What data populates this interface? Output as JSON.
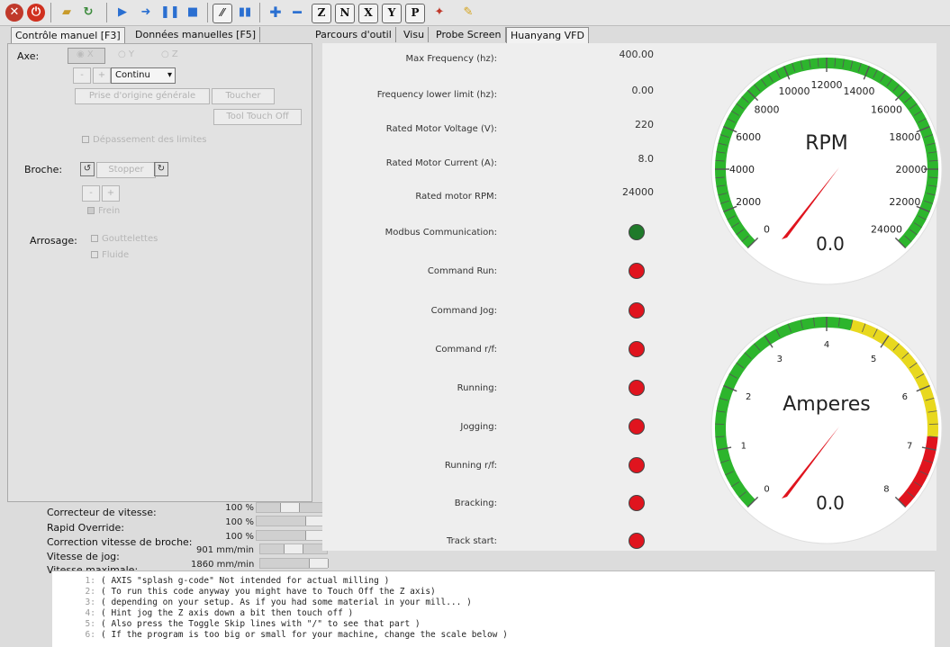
{
  "toolbar": {
    "icons": [
      "stop-icon",
      "estop-icon",
      "open-folder-icon",
      "reload-icon",
      "run-icon",
      "step-icon",
      "pause-icon",
      "stop-program-icon",
      "block-delete-icon",
      "optional-stop-icon",
      "zoom-in-icon",
      "zoom-out-icon",
      "view-z-icon",
      "view-rotated-z-icon",
      "view-x-icon",
      "view-y-icon",
      "view-perspective-icon",
      "rotate-view-icon",
      "clear-plot-icon"
    ],
    "view_z": "Z",
    "view_rz": "N",
    "view_x": "X",
    "view_y": "Y",
    "view_p": "P"
  },
  "tabs_left": [
    "Contrôle manuel [F3]",
    "Données manuelles [F5]"
  ],
  "tabs_right": [
    "Parcours d'outil",
    "Visu",
    "Probe Screen",
    "Huanyang VFD"
  ],
  "manual": {
    "axis_label": "Axe:",
    "axes": [
      "X",
      "Y",
      "Z"
    ],
    "minus": "-",
    "plus": "+",
    "jog_mode": "Continu",
    "home_button": "Prise d'origine générale",
    "touch_button": "Toucher",
    "tool_touch_off": "Tool Touch Off",
    "override_limits": "Dépassement des limites",
    "spindle_label": "Broche:",
    "spindle_stop": "Stopper",
    "brake": "Frein",
    "coolant_label": "Arrosage:",
    "mist": "Gouttelettes",
    "flood": "Fluide"
  },
  "overrides": [
    {
      "label": "Correcteur de vitesse:",
      "value": "100 %"
    },
    {
      "label": "Rapid Override:",
      "value": "100 %"
    },
    {
      "label": "Correction vitesse de broche:",
      "value": "100 %"
    },
    {
      "label": "Vitesse de jog:",
      "value": "901 mm/min"
    },
    {
      "label": "Vitesse maximale:",
      "value": "1860 mm/min"
    }
  ],
  "vfd": {
    "params": [
      {
        "label": "Max Frequency (hz):",
        "value": "400.00"
      },
      {
        "label": "Frequency lower limit (hz):",
        "value": "0.00"
      },
      {
        "label": "Rated Motor Voltage (V):",
        "value": "220"
      },
      {
        "label": "Rated Motor Current (A):",
        "value": "8.0"
      },
      {
        "label": "Rated motor RPM:",
        "value": "24000"
      }
    ],
    "status": [
      {
        "label": "Modbus Communication:",
        "color": "#1f7a2a"
      },
      {
        "label": "Command Run:",
        "color": "#e0141e"
      },
      {
        "label": "Command Jog:",
        "color": "#e0141e"
      },
      {
        "label": "Command r/f:",
        "color": "#e0141e"
      },
      {
        "label": "Running:",
        "color": "#e0141e"
      },
      {
        "label": "Jogging:",
        "color": "#e0141e"
      },
      {
        "label": "Running r/f:",
        "color": "#e0141e"
      },
      {
        "label": "Bracking:",
        "color": "#e0141e"
      },
      {
        "label": "Track start:",
        "color": "#e0141e"
      }
    ]
  },
  "gauges": {
    "rpm": {
      "title": "RPM",
      "readout": "0.0",
      "value": 0,
      "min": 0,
      "max": 24000,
      "labels": [
        "0",
        "2000",
        "4000",
        "6000",
        "8000",
        "10000",
        "12000",
        "14000",
        "16000",
        "18000",
        "20000",
        "22000",
        "24000"
      ]
    },
    "amps": {
      "title": "Amperes",
      "readout": "0.0",
      "value": 0,
      "min": 0,
      "max": 8,
      "labels": [
        "0",
        "1",
        "2",
        "3",
        "4",
        "5",
        "6",
        "7",
        "8"
      ]
    }
  },
  "gcode": {
    "lines": [
      {
        "n": "1:",
        "text": "( AXIS \"splash g-code\" Not intended for actual milling )"
      },
      {
        "n": "2:",
        "text": "( To run this code anyway you might have to Touch Off the Z axis)"
      },
      {
        "n": "3:",
        "text": "( depending on your setup. As if you had some material in your mill... )"
      },
      {
        "n": "4:",
        "text": "( Hint jog the Z axis down a bit then touch off )"
      },
      {
        "n": "5:",
        "text": "( Also press the Toggle Skip lines with \"/\" to see that part )"
      },
      {
        "n": "6:",
        "text": "( If the program is too big or small for your machine, change the scale below )"
      }
    ]
  }
}
